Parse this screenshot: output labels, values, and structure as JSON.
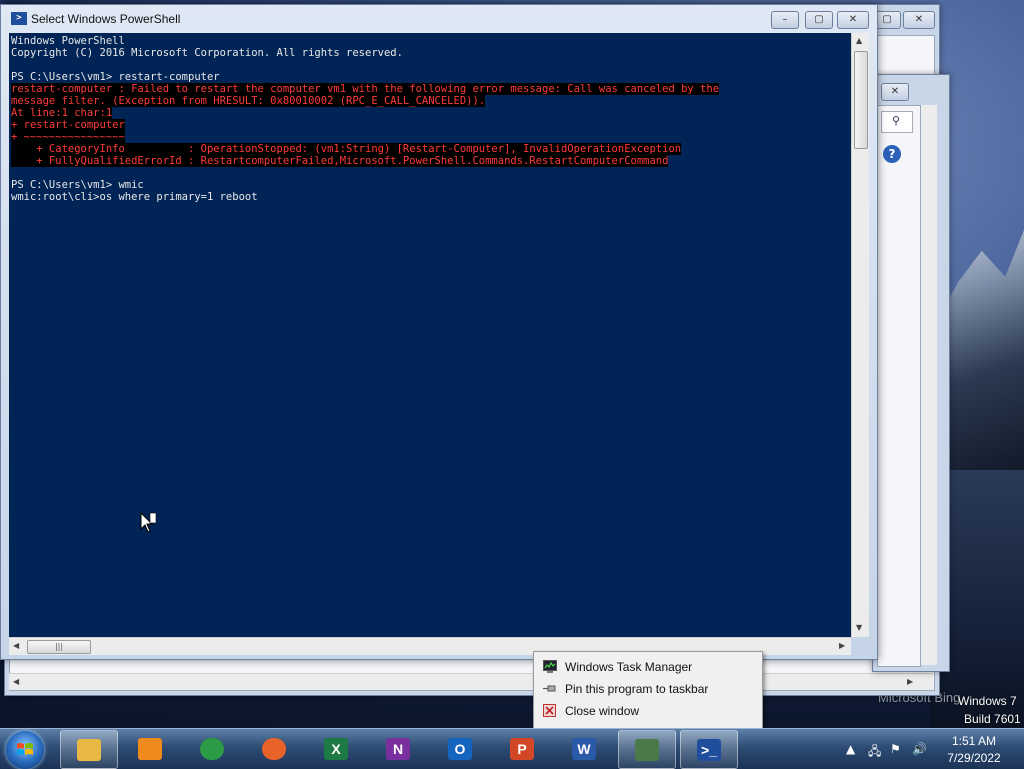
{
  "powershell": {
    "title": "Select Windows PowerShell",
    "console_lines": [
      {
        "text": "Windows PowerShell",
        "error": false
      },
      {
        "text": "Copyright (C) 2016 Microsoft Corporation. All rights reserved.",
        "error": false
      },
      {
        "text": "",
        "error": false
      },
      {
        "text": "PS C:\\Users\\vm1> restart-computer",
        "error": false
      },
      {
        "text": "restart-computer : Failed to restart the computer vm1 with the following error message: Call was canceled by the",
        "error": true
      },
      {
        "text": "message filter. (Exception from HRESULT: 0x80010002 (RPC_E_CALL_CANCELED)).",
        "error": true
      },
      {
        "text": "At line:1 char:1",
        "error": true
      },
      {
        "text": "+ restart-computer",
        "error": true
      },
      {
        "text": "+ ~~~~~~~~~~~~~~~~",
        "error": true
      },
      {
        "text": "    + CategoryInfo          : OperationStopped: (vm1:String) [Restart-Computer], InvalidOperationException",
        "error": true
      },
      {
        "text": "    + FullyQualifiedErrorId : RestartcomputerFailed,Microsoft.PowerShell.Commands.RestartComputerCommand",
        "error": true
      },
      {
        "text": "",
        "error": false
      },
      {
        "text": "PS C:\\Users\\vm1> wmic",
        "error": false
      },
      {
        "text": "wmic:root\\cli>os where primary=1 reboot",
        "error": false
      }
    ],
    "hscroll_grip": "|||",
    "console_bg": "#012456"
  },
  "jump_menu": {
    "items": [
      {
        "label": "Windows Task Manager",
        "icon": "task-manager-icon"
      },
      {
        "label": "Pin this program to taskbar",
        "icon": "pin-icon"
      },
      {
        "label": "Close window",
        "icon": "close-window-icon"
      }
    ]
  },
  "desktop": {
    "watermark": "Microsoft Bing",
    "os_line1": "Windows 7",
    "os_line2": "Build 7601"
  },
  "taskbar": {
    "apps": [
      {
        "name": "file-explorer",
        "letter": "",
        "color": "#e8b844",
        "active": true
      },
      {
        "name": "windows-media-player",
        "letter": "",
        "color": "#f08a1c",
        "active": false
      },
      {
        "name": "chrome",
        "letter": "",
        "color": "#2c9b45",
        "active": false
      },
      {
        "name": "firefox",
        "letter": "",
        "color": "#e8622a",
        "active": false
      },
      {
        "name": "excel",
        "letter": "X",
        "color": "#1d7a45",
        "active": false
      },
      {
        "name": "onenote",
        "letter": "N",
        "color": "#7a2f9e",
        "active": false
      },
      {
        "name": "outlook",
        "letter": "O",
        "color": "#1565c0",
        "active": false
      },
      {
        "name": "powerpoint",
        "letter": "P",
        "color": "#d24726",
        "active": false
      },
      {
        "name": "word",
        "letter": "W",
        "color": "#2b5ba8",
        "active": false
      },
      {
        "name": "task-manager",
        "letter": "",
        "color": "#4a7a4a",
        "active": true
      },
      {
        "name": "powershell",
        "letter": ">_",
        "color": "#1f4f9c",
        "active": true
      }
    ],
    "time": "1:51 AM",
    "date": "7/29/2022"
  }
}
